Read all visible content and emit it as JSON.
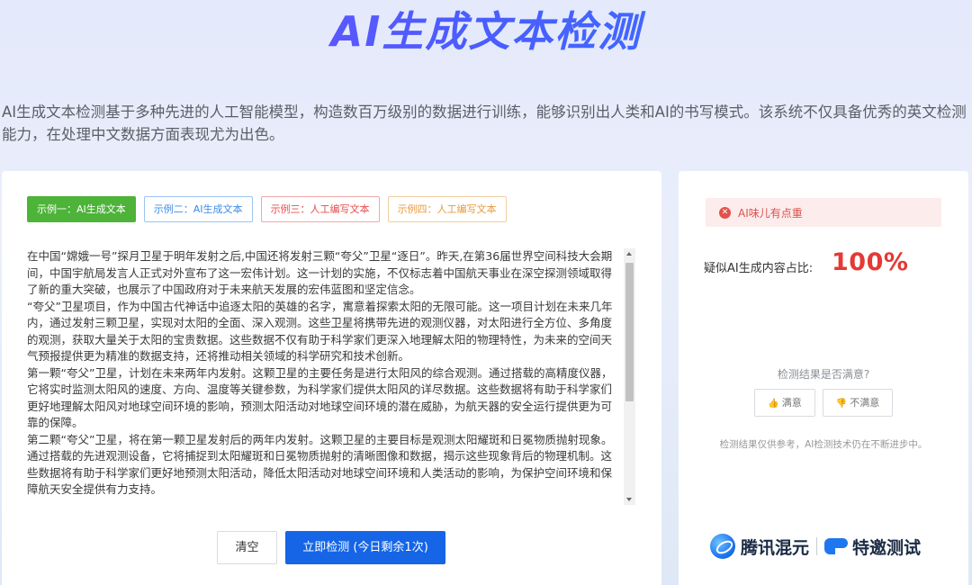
{
  "header": {
    "title": "AI生成文本检测",
    "intro": "AI生成文本检测基于多种先进的人工智能模型，构造数百万级别的数据进行训练，能够识别出人类和AI的书写模式。该系统不仅具备优秀的英文检测能力，在处理中文数据方面表现尤为出色。"
  },
  "examples": [
    {
      "label": "示例一：AI生成文本",
      "active": true
    },
    {
      "label": "示例二：AI生成文本",
      "active": false
    },
    {
      "label": "示例三：人工编写文本",
      "active": false
    },
    {
      "label": "示例四：人工编写文本",
      "active": false
    }
  ],
  "input": {
    "paragraphs": [
      "在中国“嫦娥一号”探月卫星于明年发射之后,中国还将发射三颗“夸父”卫星“逐日”。昨天,在第36届世界空间科技大会期间，中国宇航局发言人正式对外宣布了这一宏伟计划。这一计划的实施，不仅标志着中国航天事业在深空探测领域取得了新的重大突破，也展示了中国政府对于未来航天发展的宏伟蓝图和坚定信念。",
      "“夸父”卫星项目，作为中国古代神话中追逐太阳的英雄的名字，寓意着探索太阳的无限可能。这一项目计划在未来几年内，通过发射三颗卫星，实现对太阳的全面、深入观测。这些卫星将携带先进的观测仪器，对太阳进行全方位、多角度的观测，获取大量关于太阳的宝贵数据。这些数据不仅有助于科学家们更深入地理解太阳的物理特性，为未来的空间天气预报提供更为精准的数据支持，还将推动相关领域的科学研究和技术创新。",
      "第一颗“夸父”卫星，计划在未来两年内发射。这颗卫星的主要任务是进行太阳风的综合观测。通过搭载的高精度仪器，它将实时监测太阳风的速度、方向、温度等关键参数，为科学家们提供太阳风的详尽数据。这些数据将有助于科学家们更好地理解太阳风对地球空间环境的影响，预测太阳活动对地球空间环境的潜在威胁，为航天器的安全运行提供更为可靠的保障。",
      "第二颗“夸父”卫星，将在第一颗卫星发射后的两年内发射。这颗卫星的主要目标是观测太阳耀斑和日冕物质抛射现象。通过搭载的先进观测设备，它将捕捉到太阳耀斑和日冕物质抛射的清晰图像和数据，揭示这些现象背后的物理机制。这些数据将有助于科学家们更好地预测太阳活动，降低太阳活动对地球空间环境和人类活动的影响，为保护空间环境和保障航天安全提供有力支持。"
    ]
  },
  "actions": {
    "clear_label": "清空",
    "detect_label": "立即检测 (今日剩余1次)"
  },
  "result": {
    "alert_icon": "x-circle-icon",
    "alert_text": "AI味儿有点重",
    "ratio_label": "疑似AI生成内容占比:",
    "ratio_value": "100%",
    "satisfy_question": "检测结果是否满意?",
    "good_label": "满意",
    "bad_label": "不满意",
    "note": "检测结果仅供参考，AI检测技术仍在不断进步中。"
  },
  "branding": {
    "brand1": "腾讯混元",
    "brand2": "特邀测试"
  }
}
